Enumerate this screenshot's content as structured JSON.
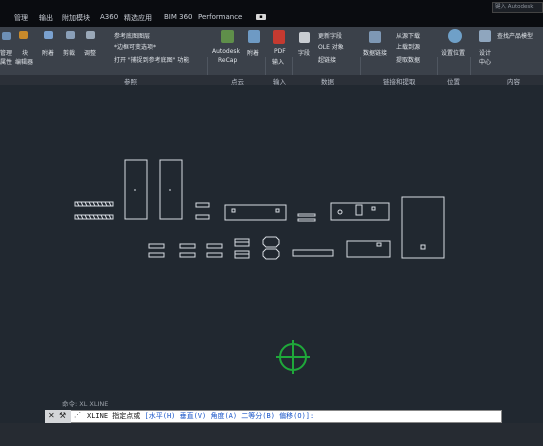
{
  "tabs": [
    "管理",
    "输出",
    "附加模块",
    "A360",
    "精选应用",
    "BIM 360",
    "Performance"
  ],
  "search_placeholder": "键入 Autodesk",
  "ribbon": {
    "btn_manage": "管理",
    "btn_attr": "属性",
    "btn_block": "块",
    "btn_editor": "编辑器",
    "btn_attach": "附着",
    "btn_clip": "剪裁",
    "btn_adjust": "调整",
    "btn_underlay_layers": "参考底图图层",
    "btn_frames": "*边框可变选项*",
    "btn_snap": "打开 \"捕捉到参考底图\" 功能",
    "btn_recap": "Autodesk",
    "btn_recap2": "ReCap",
    "btn_attach2": "附着",
    "btn_pdf": "PDF",
    "btn_pdf2": "输入",
    "btn_field": "字段",
    "btn_update_fields": "更新字段",
    "btn_ole": "OLE 对象",
    "btn_hyperlink": "超链接",
    "btn_data_link": "数据链接",
    "btn_download": "从源下载",
    "btn_upload": "上载到源",
    "btn_extract": "提取数据",
    "btn_location": "设置位置",
    "btn_design": "设计",
    "btn_design2": "中心",
    "btn_product": "查找产品模型",
    "panel_reference": "参照",
    "panel_pointcloud": "点云",
    "panel_import": "输入",
    "panel_data": "数据",
    "panel_link": "链接和提取",
    "panel_location": "位置",
    "panel_content": "内容"
  },
  "command": {
    "history": "命令: XL XLINE",
    "prompt": "XLINE 指定点或",
    "options": "[水平(H) 垂直(V) 角度(A) 二等分(B) 偏移(O)]:"
  },
  "colors": {
    "drawing": "#d8dce2",
    "cursor": "#1fa83a",
    "canvas": "#212830"
  }
}
